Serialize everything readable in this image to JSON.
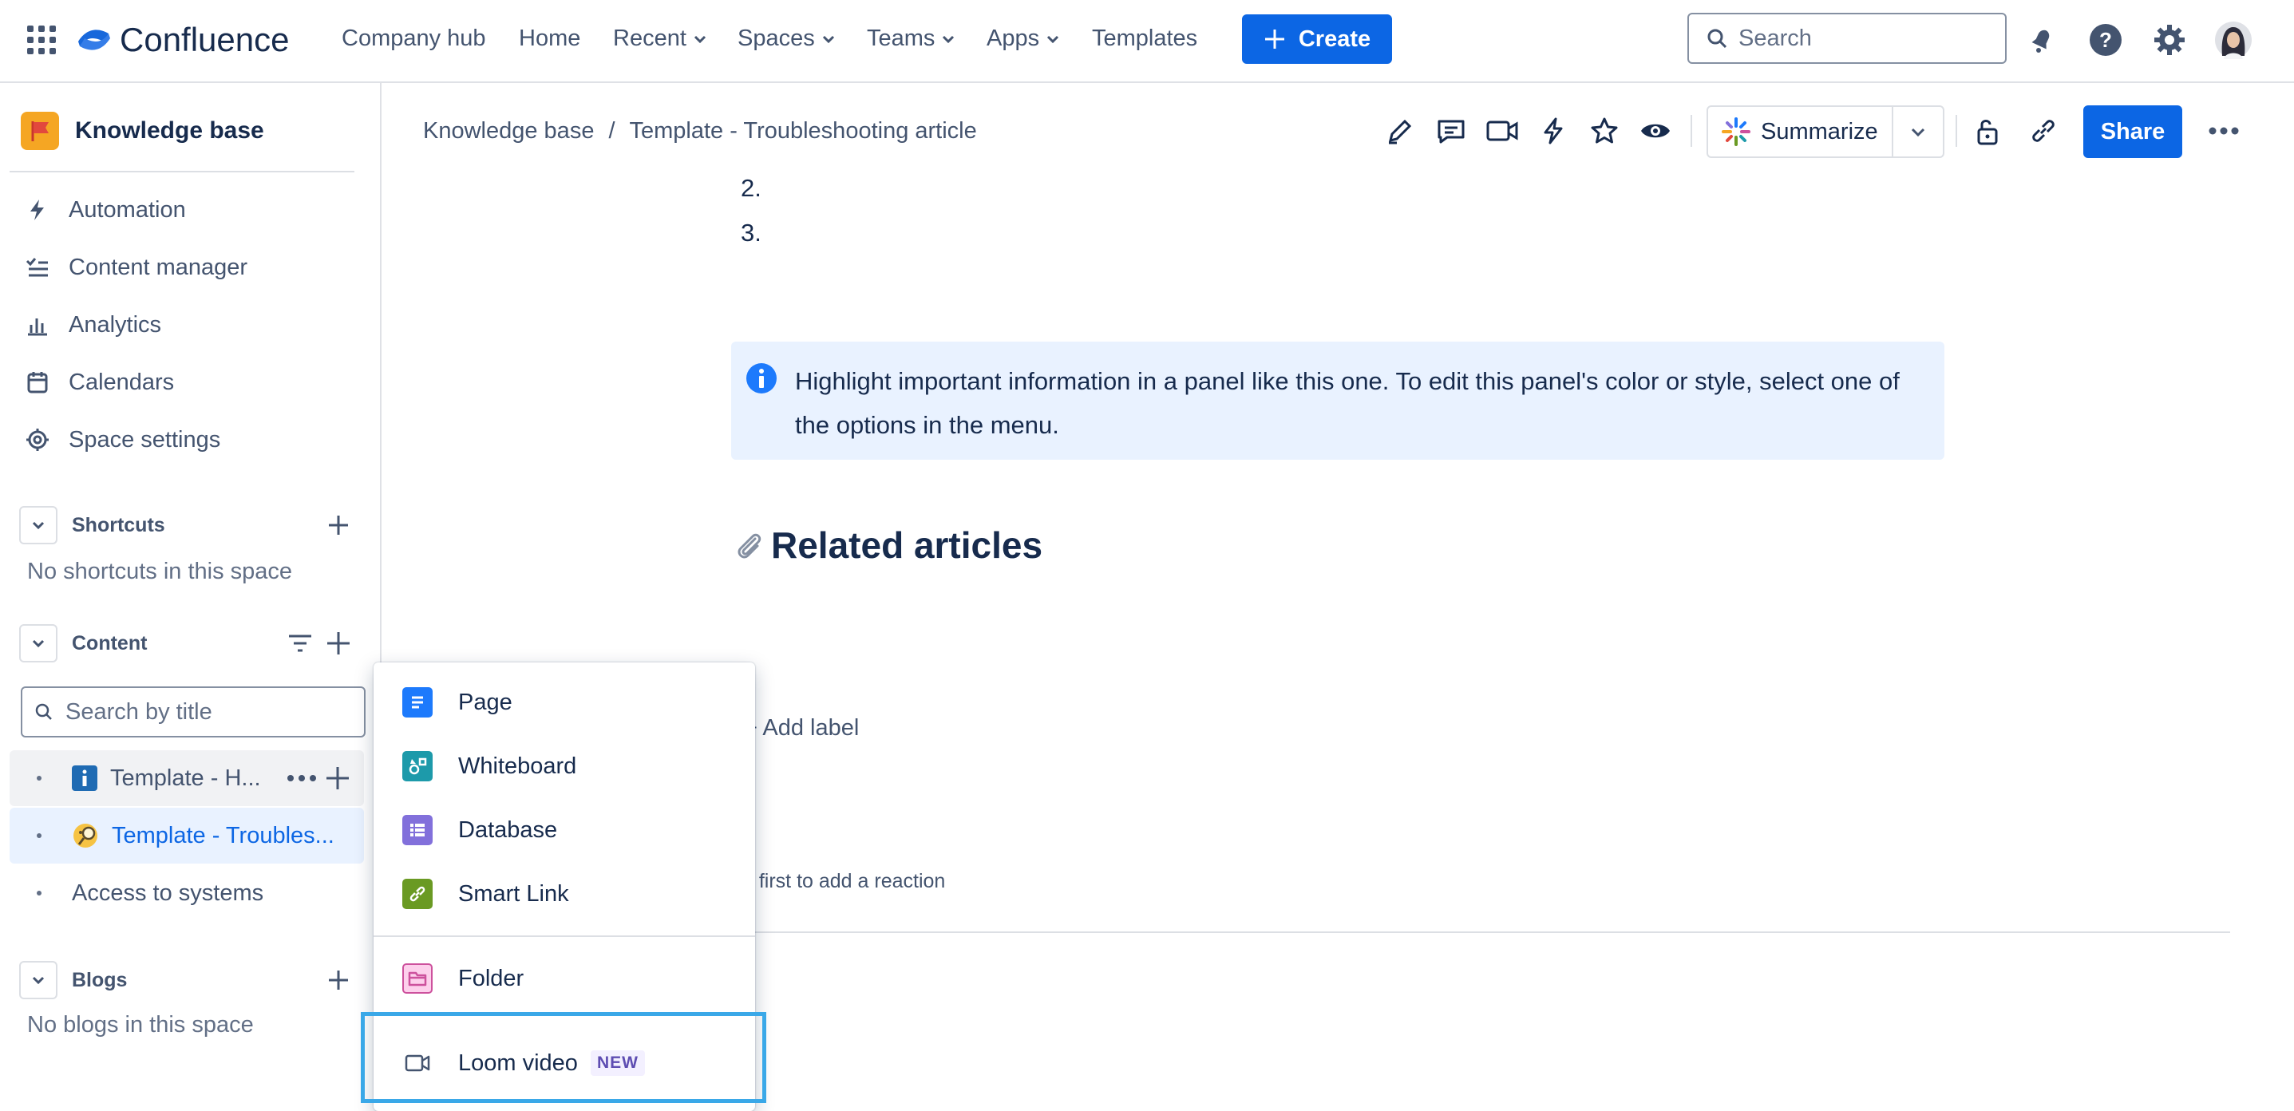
{
  "topnav": {
    "product_name": "Confluence",
    "links": [
      "Company hub",
      "Home",
      "Recent",
      "Spaces",
      "Teams",
      "Apps",
      "Templates"
    ],
    "create_label": "Create",
    "search_placeholder": "Search",
    "icons": [
      "app-switcher-icon",
      "notifications-icon",
      "help-icon",
      "settings-icon",
      "profile-avatar"
    ]
  },
  "sidebar": {
    "space_name": "Knowledge base",
    "items": [
      {
        "label": "Automation",
        "icon": "lightning-icon"
      },
      {
        "label": "Content manager",
        "icon": "content-manager-icon"
      },
      {
        "label": "Analytics",
        "icon": "analytics-icon"
      },
      {
        "label": "Calendars",
        "icon": "calendar-icon"
      },
      {
        "label": "Space settings",
        "icon": "gear-icon"
      }
    ],
    "shortcuts": {
      "title": "Shortcuts",
      "empty": "No shortcuts in this space"
    },
    "content": {
      "title": "Content",
      "search_placeholder": "Search by title",
      "tree": [
        {
          "label": "Template - H...",
          "icon": "info-icon"
        },
        {
          "label": "Template - Troubles...",
          "icon": "magnifier-emoji"
        },
        {
          "label": "Access to systems"
        }
      ]
    },
    "blogs": {
      "title": "Blogs",
      "empty": "No blogs in this space"
    }
  },
  "page": {
    "breadcrumb": [
      "Knowledge base",
      "Template - Troubleshooting article"
    ],
    "breadcrumb_sep": "/",
    "summarize_label": "Summarize",
    "share_label": "Share",
    "list_numbers": [
      "2.",
      "3."
    ],
    "info_panel_text": "Highlight important information in a panel like this one. To edit this panel's color or style, select one of the options in the menu.",
    "related_heading": "Related articles",
    "add_label": "+ Add label",
    "reaction_text": "e first to add a reaction"
  },
  "create_menu": {
    "items": [
      {
        "label": "Page",
        "icon": "page-icon",
        "color": "#1d7afc"
      },
      {
        "label": "Whiteboard",
        "icon": "whiteboard-icon",
        "color": "#1d9aaa"
      },
      {
        "label": "Database",
        "icon": "database-icon",
        "color": "#8270db"
      },
      {
        "label": "Smart Link",
        "icon": "smart-link-icon",
        "color": "#6a9a23"
      },
      {
        "label": "Folder",
        "icon": "folder-icon",
        "color": "#cd519d"
      }
    ],
    "loom": {
      "label": "Loom video",
      "badge": "NEW",
      "icon": "video-icon"
    }
  },
  "colors": {
    "brand_blue": "#0c66e4",
    "highlight_border": "#3aa8e8",
    "info_panel": "#e9f2ff"
  }
}
